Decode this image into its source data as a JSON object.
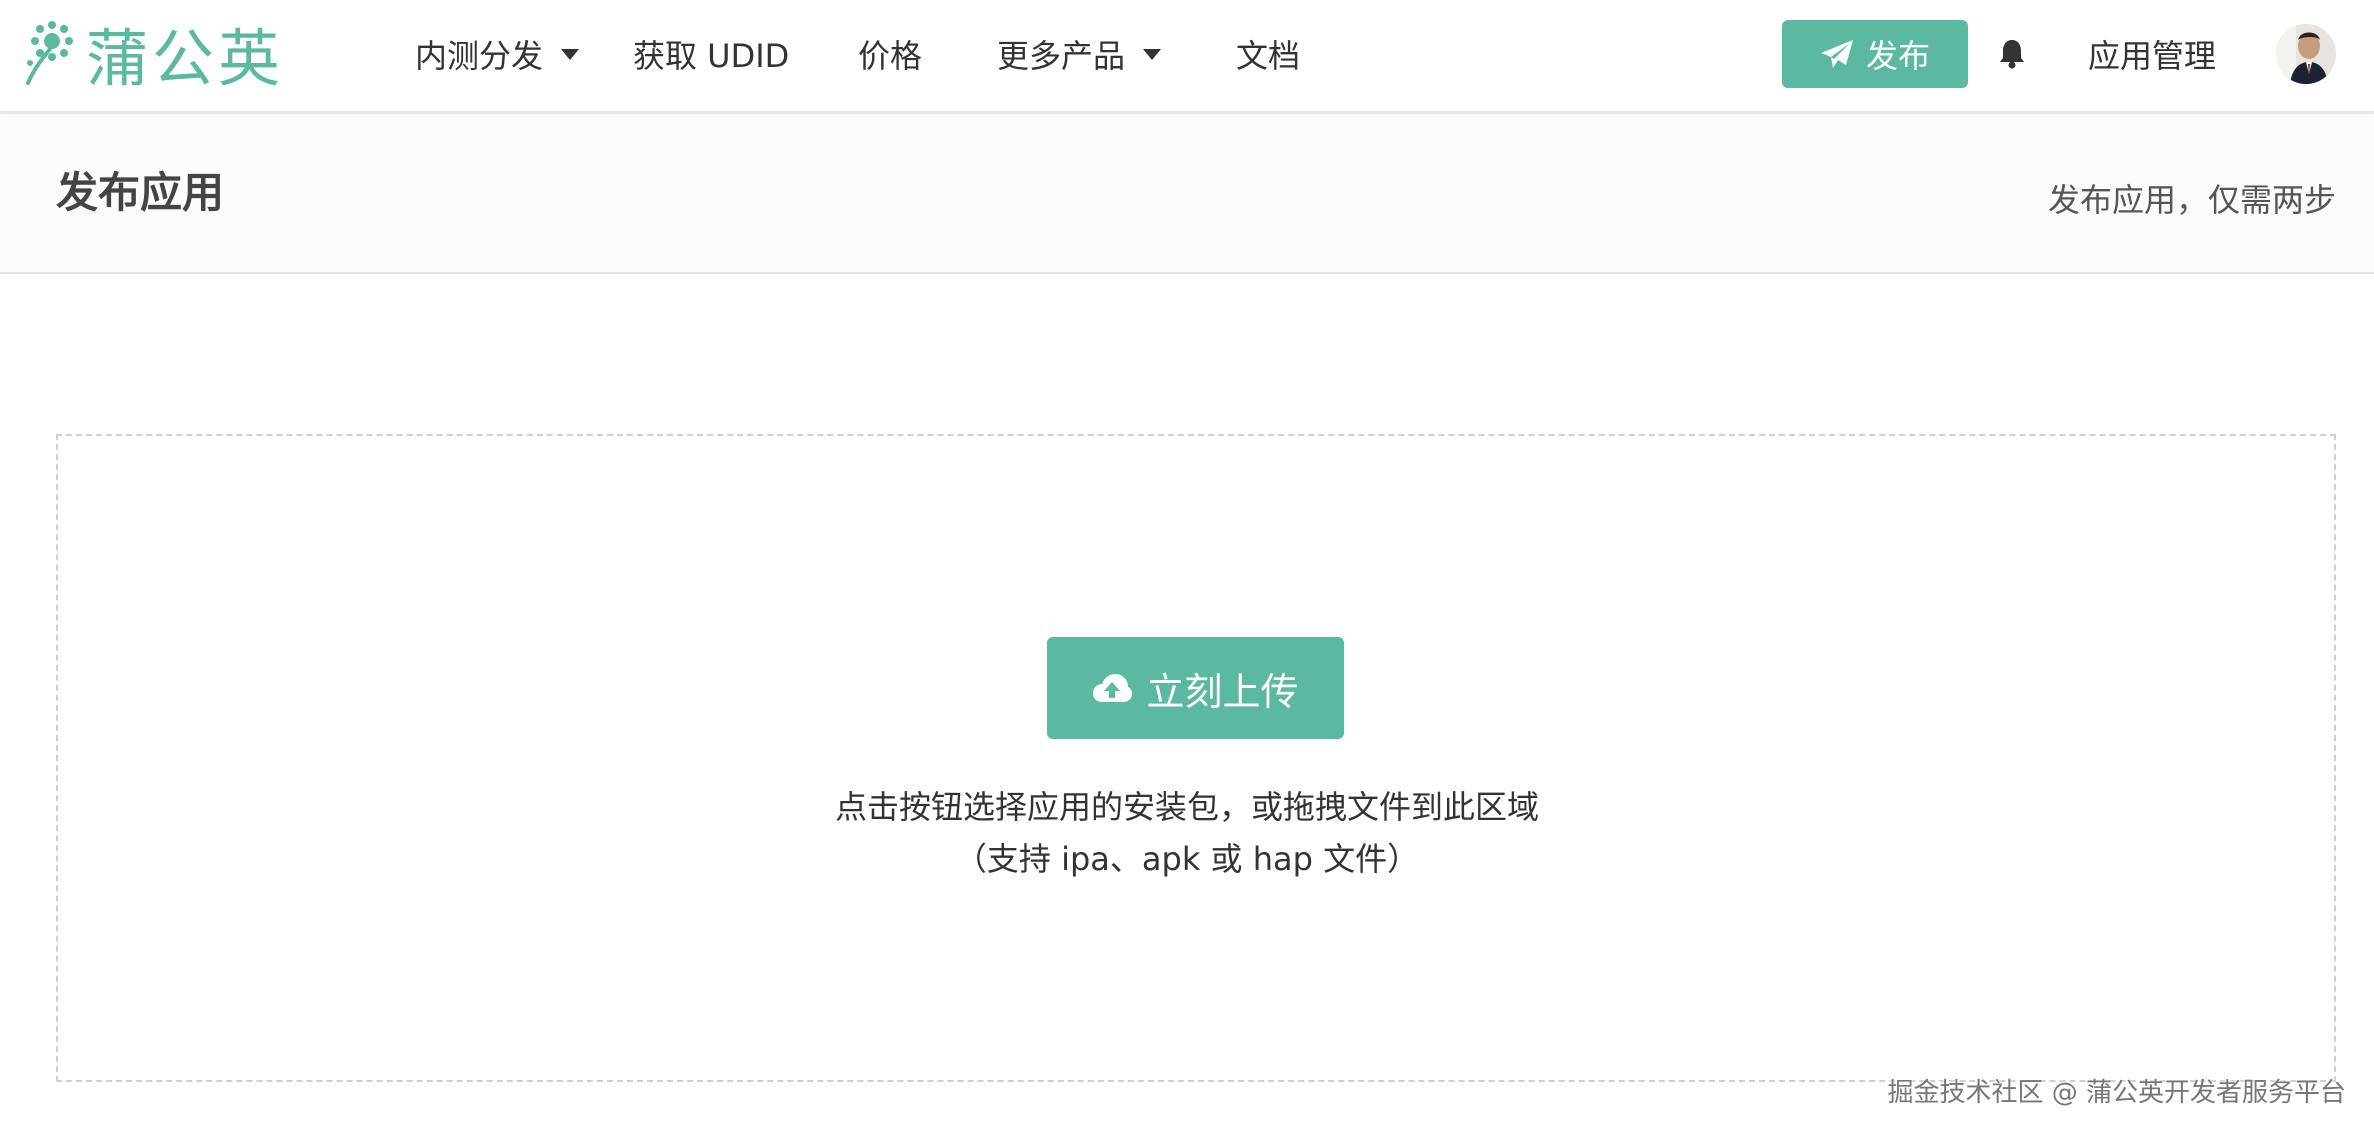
{
  "brand": {
    "name": "蒲公英",
    "color": "#5ab9a0"
  },
  "nav": {
    "items": [
      {
        "label": "内测分发",
        "dropdown": true
      },
      {
        "label": "获取 UDID",
        "dropdown": false
      },
      {
        "label": "价格",
        "dropdown": false
      },
      {
        "label": "更多产品",
        "dropdown": true
      },
      {
        "label": "文档",
        "dropdown": false
      }
    ]
  },
  "header": {
    "publish_label": "发布",
    "app_manage_label": "应用管理",
    "bell_icon": "bell-icon",
    "publish_icon": "paper-plane-icon"
  },
  "page": {
    "title": "发布应用",
    "subtitle": "发布应用，仅需两步"
  },
  "upload": {
    "button_label": "立刻上传",
    "button_icon": "cloud-upload-icon",
    "hint_line1": "点击按钮选择应用的安装包，或拖拽文件到此区域",
    "hint_line2": "（支持 ipa、apk 或 hap 文件）"
  },
  "watermark": "掘金技术社区 @ 蒲公英开发者服务平台"
}
